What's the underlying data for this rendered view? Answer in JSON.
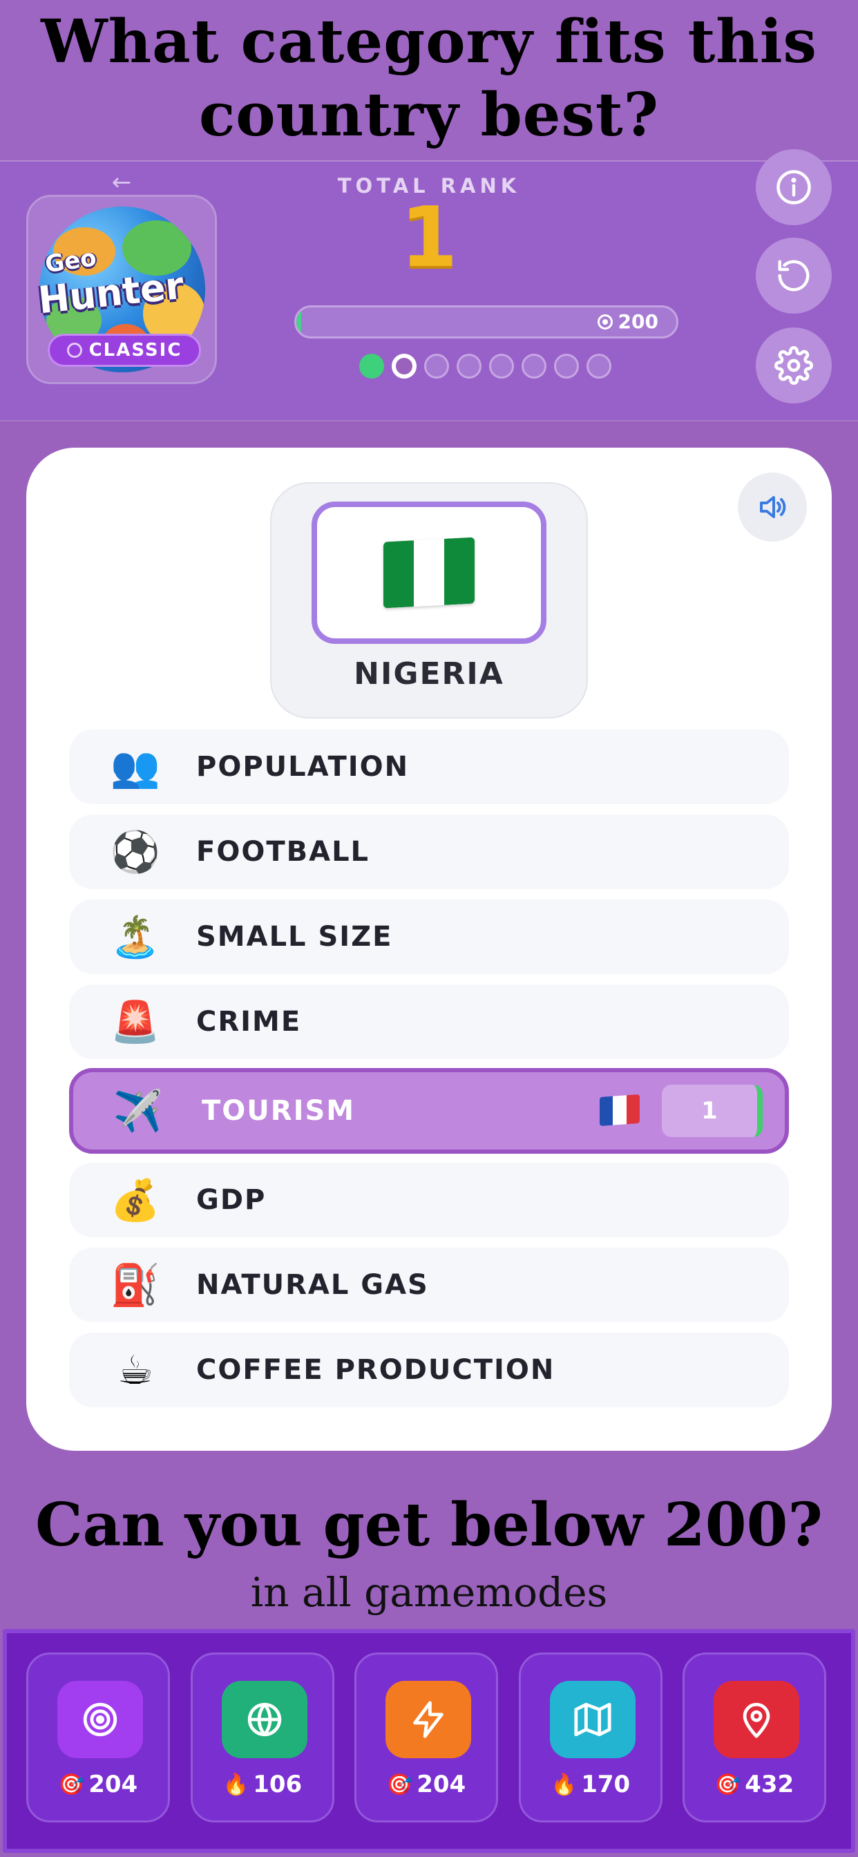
{
  "headline": "What category fits this country best?",
  "header": {
    "back_icon": "arrow-left-icon",
    "logo": {
      "line1": "Geo",
      "line2": "Hunter",
      "badge": "CLASSIC"
    },
    "total_rank_label": "TOTAL RANK",
    "total_rank_value": "1",
    "progress": {
      "value_label": "200",
      "fill_fraction": 0.01
    },
    "round_dots": {
      "total": 8,
      "completed": 1,
      "current_index": 1
    },
    "buttons": [
      "info-icon",
      "reload-icon",
      "gear-icon"
    ]
  },
  "question": {
    "country_name": "NIGERIA",
    "flag_colors": [
      "#0f8a3a",
      "#ffffff",
      "#0f8a3a"
    ],
    "sound_icon": "speaker-icon"
  },
  "categories": [
    {
      "icon": "👥",
      "label": "POPULATION"
    },
    {
      "icon": "⚽",
      "label": "FOOTBALL"
    },
    {
      "icon": "🏝️",
      "label": "SMALL SIZE"
    },
    {
      "icon": "🚨",
      "label": "CRIME"
    },
    {
      "icon": "✈️",
      "label": "TOURISM",
      "selected": true,
      "assigned_flag": "🇫🇷",
      "rank": "1"
    },
    {
      "icon": "💰",
      "label": "GDP"
    },
    {
      "icon": "⛽",
      "label": "NATURAL GAS"
    },
    {
      "icon": "☕",
      "label": "COFFEE PRODUCTION"
    }
  ],
  "cta": {
    "title": "Can you get below 200?",
    "subtitle": "in all gamemodes"
  },
  "modes": [
    {
      "icon": "target-icon",
      "color": "#a23df0",
      "emoji": "🎯",
      "score": "204"
    },
    {
      "icon": "globe-icon",
      "color": "#22b07a",
      "emoji": "🔥",
      "score": "106"
    },
    {
      "icon": "bolt-icon",
      "color": "#f47a22",
      "emoji": "🎯",
      "score": "204"
    },
    {
      "icon": "map-icon",
      "color": "#22b4d0",
      "emoji": "🔥",
      "score": "170"
    },
    {
      "icon": "pin-icon",
      "color": "#e02a3a",
      "emoji": "🎯",
      "score": "432"
    }
  ]
}
